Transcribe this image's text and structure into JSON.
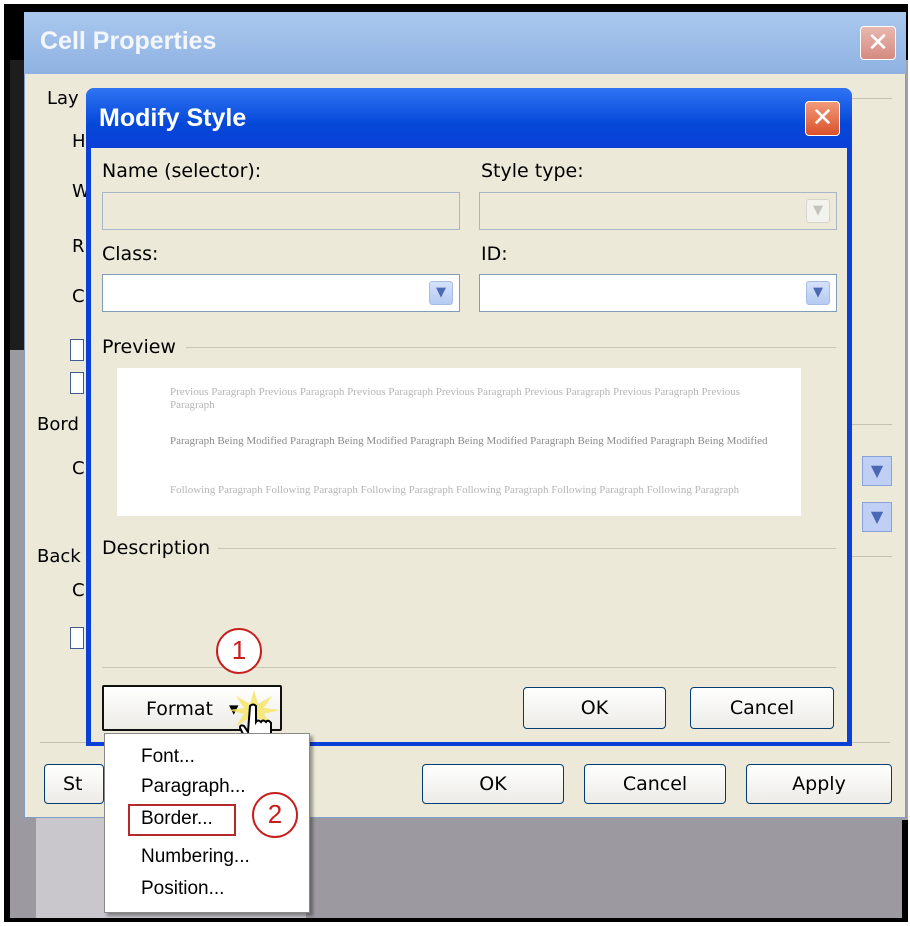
{
  "cell_properties": {
    "title": "Cell Properties",
    "close_glyph": "✕",
    "side_fragments": [
      "Lay",
      "H",
      "W",
      "R",
      "C",
      "Bord",
      "C",
      "Back",
      "C"
    ],
    "buttons": {
      "style_fragment": "St",
      "ok": "OK",
      "cancel": "Cancel",
      "apply": "Apply"
    }
  },
  "modify_style": {
    "title": "Modify Style",
    "close_glyph": "✕",
    "name_label": "Name (selector):",
    "name_value": "",
    "style_type_label": "Style type:",
    "style_type_value": "",
    "class_label": "Class:",
    "class_value": "",
    "id_label": "ID:",
    "id_value": "",
    "preview_label": "Preview",
    "preview_text": {
      "previous": "Previous Paragraph Previous Paragraph Previous Paragraph Previous Paragraph Previous Paragraph Previous Paragraph Previous Paragraph",
      "current": "Paragraph Being Modified Paragraph Being Modified Paragraph Being Modified Paragraph Being Modified Paragraph Being Modified",
      "following": "Following Paragraph Following Paragraph Following Paragraph Following Paragraph Following Paragraph Following Paragraph"
    },
    "description_label": "Description",
    "format_button": "Format",
    "format_arrow": "▾",
    "ok_button": "OK",
    "cancel_button": "Cancel"
  },
  "format_menu": {
    "items": [
      "Font...",
      "Paragraph...",
      "Border...",
      "Numbering...",
      "Position..."
    ],
    "highlighted": "Border..."
  },
  "callouts": {
    "step1": "1",
    "step2": "2"
  },
  "icons": {
    "dropdown": "chevron-down-icon",
    "cursor": "hand-cursor-icon",
    "close": "close-icon"
  },
  "colors": {
    "modify_title": "#0a3fd8",
    "cp_title": "#8fb2e2",
    "callout": "#c81e1e",
    "dialog_bg": "#ece9d8"
  }
}
